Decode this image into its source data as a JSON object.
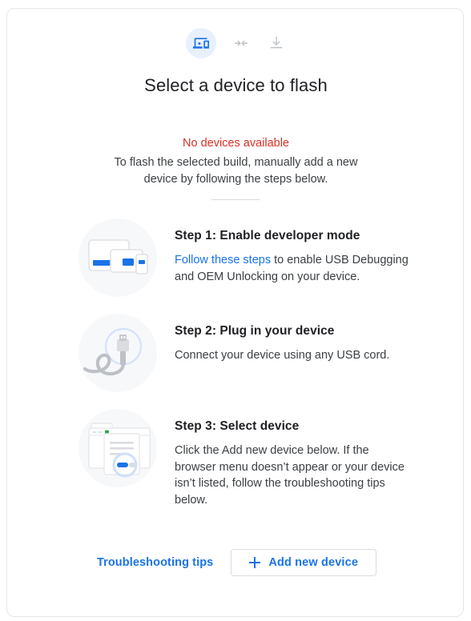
{
  "header": {
    "icons": [
      {
        "name": "devices-icon",
        "active": true
      },
      {
        "name": "connect-arrows-icon",
        "active": false
      },
      {
        "name": "download-icon",
        "active": false
      }
    ],
    "title": "Select a device to flash"
  },
  "status": {
    "error": "No devices available",
    "description": "To flash the selected build, manually add a new device by following the steps below."
  },
  "steps": [
    {
      "art": "devices-illustration",
      "title": "Step 1: Enable developer mode",
      "link_text": "Follow these steps",
      "text_after_link": " to enable USB Debugging and OEM Unlocking on your device."
    },
    {
      "art": "usb-cable-illustration",
      "title": "Step 2: Plug in your device",
      "text": "Connect your device using any USB cord."
    },
    {
      "art": "browser-dialog-illustration",
      "title": "Step 3: Select device",
      "text": "Click the Add new device below. If the browser menu doesn’t appear or your device isn’t listed, follow the troubleshooting tips below."
    }
  ],
  "footer": {
    "troubleshooting_label": "Troubleshooting tips",
    "add_device_label": "Add new device"
  },
  "colors": {
    "accent_blue": "#1a73e8",
    "error_red": "#d93025",
    "icon_bg": "#e8f0fe",
    "art_bg": "#f7f8fa",
    "border": "#dadce0",
    "text_primary": "#202124",
    "text_secondary": "#3c4043"
  }
}
